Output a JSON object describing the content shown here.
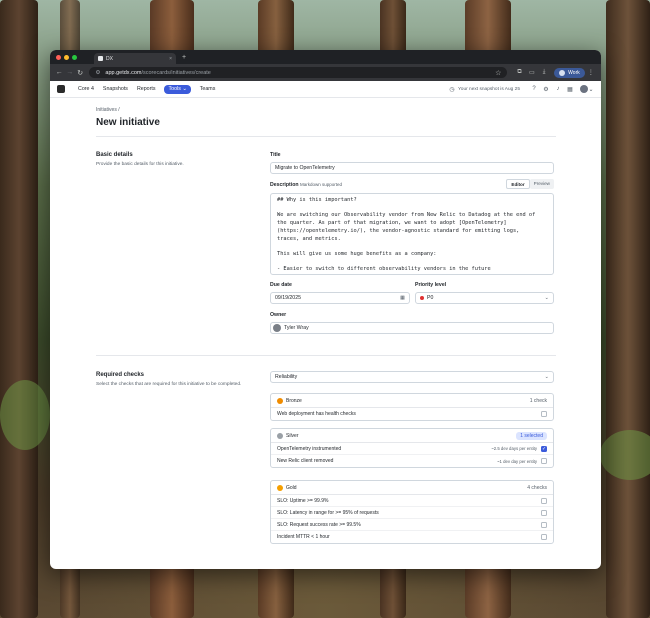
{
  "browser": {
    "tab_title": "DX",
    "tab_close": "×",
    "new_tab": "+",
    "url_host": "app.getdx.com",
    "url_path": "/scorecards/initiatives/create",
    "profile_label": "Work"
  },
  "appnav": {
    "items": [
      {
        "label": "Core 4"
      },
      {
        "label": "Snapshots"
      },
      {
        "label": "Reports"
      },
      {
        "label": "Tools ⌄"
      },
      {
        "label": "Teams"
      }
    ],
    "snapshot_notice": "Your next snapshot is Aug 25"
  },
  "page": {
    "breadcrumb": "Initiatives  /",
    "title": "New initiative"
  },
  "basic": {
    "heading": "Basic details",
    "subtext": "Provide the basic details for this initiative.",
    "title_label": "Title",
    "title_value": "Migrate to OpenTelemetry",
    "description_label": "Description",
    "description_hint": "Markdown supported",
    "editor_tab": "Editor",
    "preview_tab": "Preview",
    "description_lines": [
      "## Why is this important?",
      "",
      "We are switching our Observability vendor from New Relic to Datadog at the end of",
      "the quarter. As part of that migration, we want to adopt [OpenTelemetry]",
      "(https://opentelemetry.io/), the vendor-agnostic standard for emitting logs,",
      "traces, and metrics.",
      "",
      "This will give us some huge benefits as a company:",
      "",
      "- Easier to switch to different observability vendors in the future"
    ],
    "due_label": "Due date",
    "due_value": "09/19/2025",
    "priority_label": "Priority level",
    "priority_value": "P0",
    "owner_label": "Owner",
    "owner_value": "Tyler Wray"
  },
  "checks": {
    "heading": "Required checks",
    "subtext": "Select the checks that are required for this initiative to be completed.",
    "scorecard_value": "Reliability",
    "levels": [
      {
        "name": "Bronze",
        "badge": "1 check",
        "color": "#f08c00",
        "items": [
          {
            "label": "Web deployment has health checks",
            "effort": "",
            "checked": false
          }
        ]
      },
      {
        "name": "Silver",
        "badge": "1 selected",
        "color": "#9aa0a6",
        "items": [
          {
            "label": "OpenTelemetry instrumented",
            "effort": "~2.5 dev days per entity",
            "checked": true
          },
          {
            "label": "New Relic client removed",
            "effort": "~1 dev day per entity",
            "checked": false
          }
        ]
      },
      {
        "name": "Gold",
        "badge": "4 checks",
        "color": "#f59f00",
        "items": [
          {
            "label": "SLO: Uptime >= 99.9%",
            "effort": "",
            "checked": false
          },
          {
            "label": "SLO: Latency in range for >= 95% of requests",
            "effort": "",
            "checked": false
          },
          {
            "label": "SLO: Request success rate >= 99.5%",
            "effort": "",
            "checked": false
          },
          {
            "label": "Incident MTTR < 1 hour",
            "effort": "",
            "checked": false
          }
        ]
      }
    ]
  }
}
